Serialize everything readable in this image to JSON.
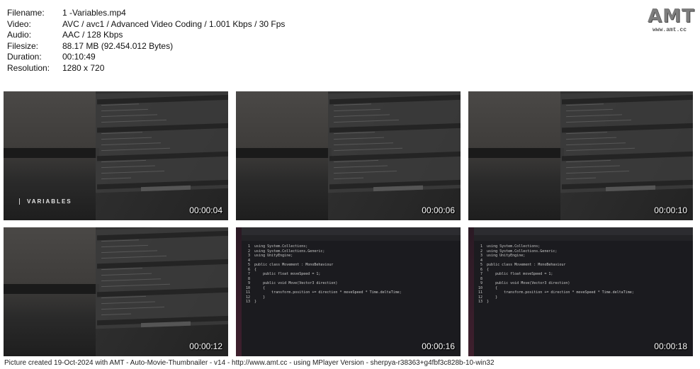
{
  "meta": [
    {
      "key": "Filename:",
      "value": "1 -Variables.mp4"
    },
    {
      "key": "Video:",
      "value": "AVC / avc1 / Advanced Video Coding / 1.001 Kbps / 30 Fps"
    },
    {
      "key": "Audio:",
      "value": "AAC / 128 Kbps"
    },
    {
      "key": "Filesize:",
      "value": "88.17 MB (92.454.012 Bytes)"
    },
    {
      "key": "Duration:",
      "value": "00:10:49"
    },
    {
      "key": "Resolution:",
      "value": "1280 x 720"
    }
  ],
  "logo": {
    "title": "AMT",
    "url": "www.amt.cc"
  },
  "thumbs": [
    {
      "time": "00:00:04",
      "kind": "unity",
      "overlay": "VARIABLES"
    },
    {
      "time": "00:00:06",
      "kind": "unity",
      "overlay": ""
    },
    {
      "time": "00:00:10",
      "kind": "unity",
      "overlay": ""
    },
    {
      "time": "00:00:12",
      "kind": "unity",
      "overlay": ""
    },
    {
      "time": "00:00:16",
      "kind": "code",
      "overlay": ""
    },
    {
      "time": "00:00:18",
      "kind": "code",
      "overlay": ""
    }
  ],
  "code_lines": [
    "using System.Collections;",
    "using System.Collections.Generic;",
    "using UnityEngine;",
    "",
    "public class Movement : MonoBehaviour",
    "{",
    "    public float moveSpeed = 1;",
    "",
    "    public void Move(Vector3 direction)",
    "    {",
    "        transform.position += direction * moveSpeed * Time.deltaTime;",
    "    }",
    "}"
  ],
  "footer": "Picture created 19-Oct-2024 with AMT - Auto-Movie-Thumbnailer - v14 - http://www.amt.cc - using MPlayer Version - sherpya-r38363+g4fbf3c828b-10-win32"
}
